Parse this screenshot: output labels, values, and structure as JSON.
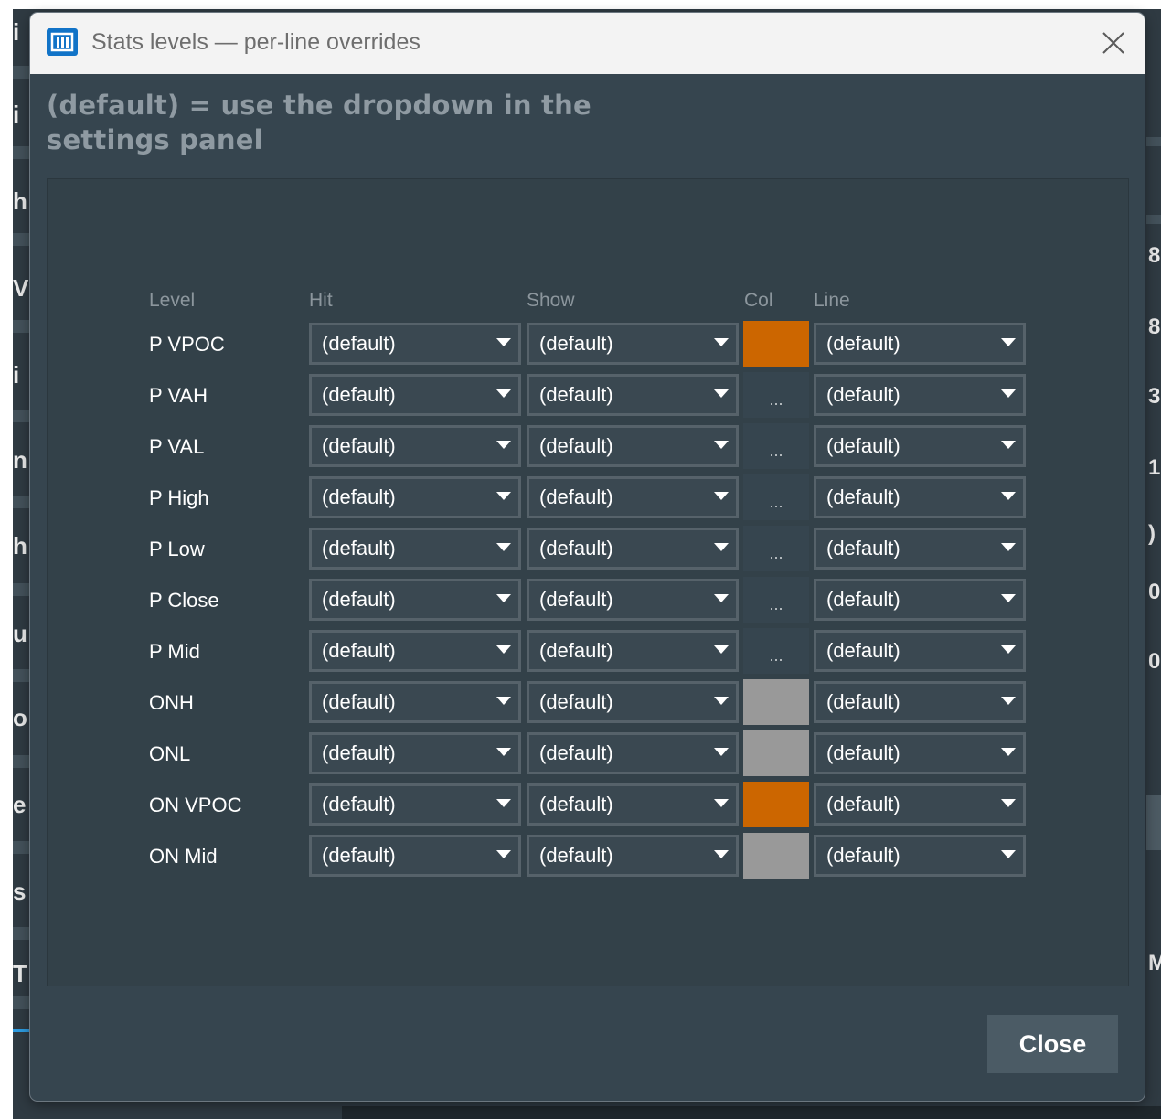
{
  "dialog": {
    "title": "Stats levels — per-line overrides",
    "hint": "(default) = use the dropdown in the settings panel",
    "close_button_label": "Close"
  },
  "table": {
    "headers": {
      "level": "Level",
      "hit": "Hit",
      "show": "Show",
      "col": "Col",
      "line": "Line"
    },
    "rows": [
      {
        "level": "P VPOC",
        "hit": "(default)",
        "show": "(default)",
        "col": {
          "type": "color",
          "color": "#cc6600",
          "text": ""
        },
        "line": "(default)"
      },
      {
        "level": "P VAH",
        "hit": "(default)",
        "show": "(default)",
        "col": {
          "type": "unset",
          "color": "#36454f",
          "text": "..."
        },
        "line": "(default)"
      },
      {
        "level": "P VAL",
        "hit": "(default)",
        "show": "(default)",
        "col": {
          "type": "unset",
          "color": "#36454f",
          "text": "..."
        },
        "line": "(default)"
      },
      {
        "level": "P High",
        "hit": "(default)",
        "show": "(default)",
        "col": {
          "type": "unset",
          "color": "#36454f",
          "text": "..."
        },
        "line": "(default)"
      },
      {
        "level": "P Low",
        "hit": "(default)",
        "show": "(default)",
        "col": {
          "type": "unset",
          "color": "#36454f",
          "text": "..."
        },
        "line": "(default)"
      },
      {
        "level": "P Close",
        "hit": "(default)",
        "show": "(default)",
        "col": {
          "type": "unset",
          "color": "#36454f",
          "text": "..."
        },
        "line": "(default)"
      },
      {
        "level": "P Mid",
        "hit": "(default)",
        "show": "(default)",
        "col": {
          "type": "unset",
          "color": "#36454f",
          "text": "..."
        },
        "line": "(default)"
      },
      {
        "level": "ONH",
        "hit": "(default)",
        "show": "(default)",
        "col": {
          "type": "color",
          "color": "#999999",
          "text": ""
        },
        "line": "(default)"
      },
      {
        "level": "ONL",
        "hit": "(default)",
        "show": "(default)",
        "col": {
          "type": "color",
          "color": "#999999",
          "text": ""
        },
        "line": "(default)"
      },
      {
        "level": "ON VPOC",
        "hit": "(default)",
        "show": "(default)",
        "col": {
          "type": "color",
          "color": "#cc6600",
          "text": ""
        },
        "line": "(default)"
      },
      {
        "level": "ON Mid",
        "hit": "(default)",
        "show": "(default)",
        "col": {
          "type": "color",
          "color": "#999999",
          "text": ""
        },
        "line": "(default)"
      }
    ]
  },
  "colors": {
    "accent_orange": "#cc6600",
    "swatch_gray": "#999999",
    "dialog_bg": "#36454f",
    "app_icon_blue": "#1173c7"
  },
  "icons": {
    "app": "app-icon",
    "close": "close-icon",
    "dropdown": "chevron-down-icon"
  }
}
